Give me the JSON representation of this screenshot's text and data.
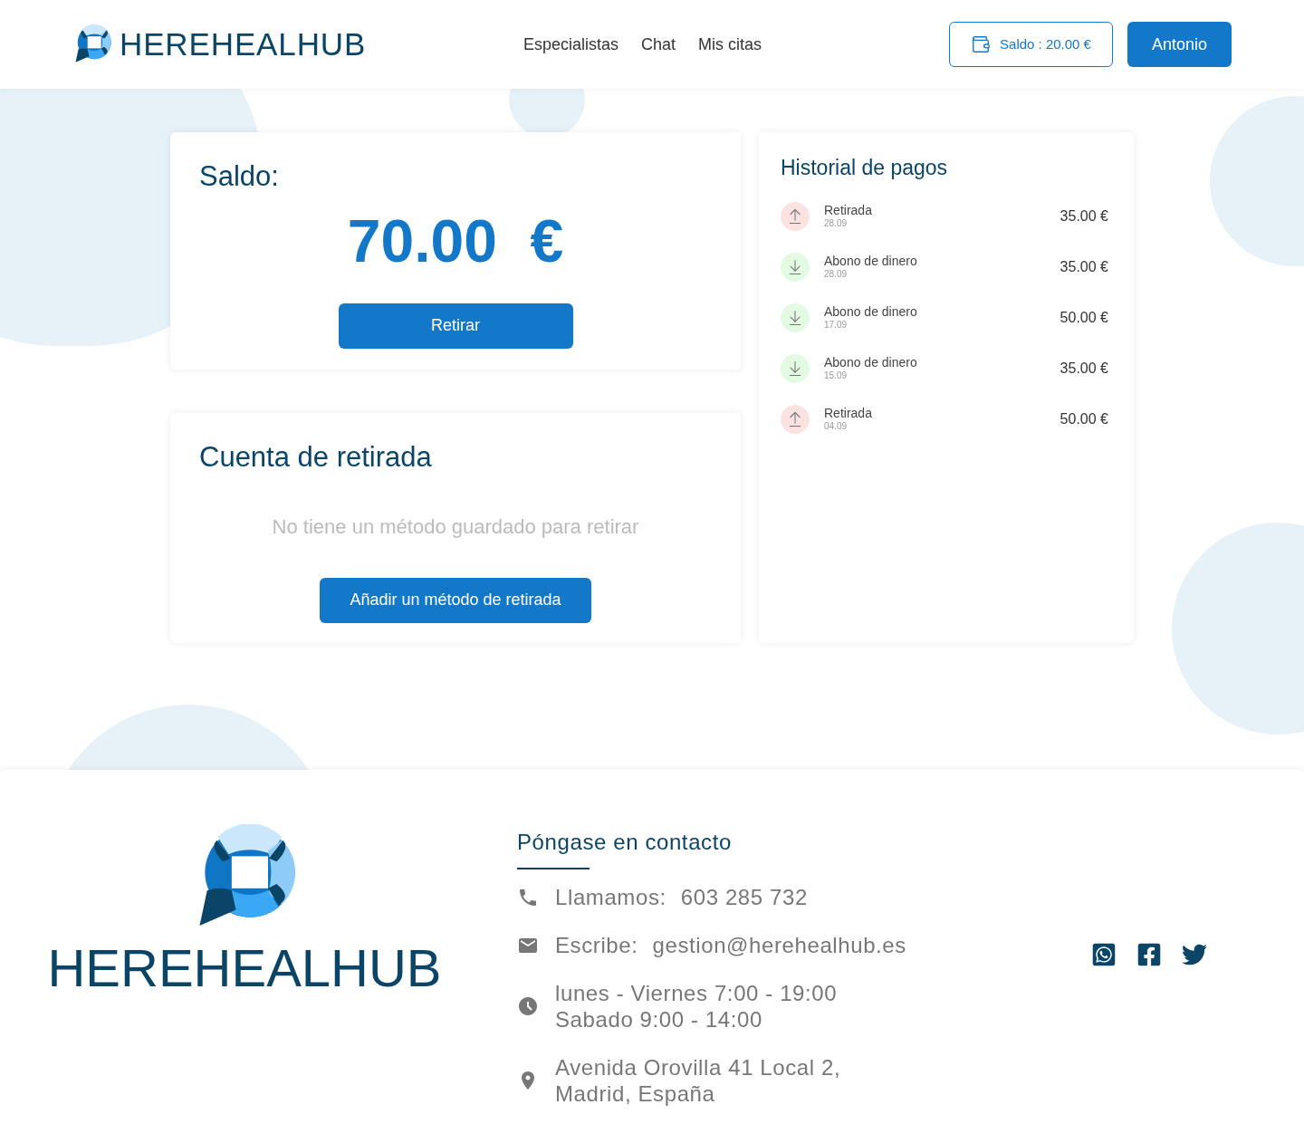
{
  "header": {
    "brand": "HEREHEALHUB",
    "nav": [
      "Especialistas",
      "Chat",
      "Mis citas"
    ],
    "balance_button": "Saldo : 20.00 €",
    "user_button": "Antonio"
  },
  "balance_card": {
    "title": "Saldo:",
    "amount": "70.00  €",
    "button": "Retirar"
  },
  "withdrawal_card": {
    "title": "Cuenta de retirada",
    "empty_message": "No tiene un método guardado para retirar",
    "button": "Añadir un método de retirada"
  },
  "payment_history": {
    "title": "Historial de pagos",
    "items": [
      {
        "kind": "withdrawal",
        "label": "Retirada",
        "date": "28.09",
        "amount": "35.00 €"
      },
      {
        "kind": "deposit",
        "label": "Abono de dinero",
        "date": "28.09",
        "amount": "35.00 €"
      },
      {
        "kind": "deposit",
        "label": "Abono de dinero",
        "date": "17.09",
        "amount": "50.00 €"
      },
      {
        "kind": "deposit",
        "label": "Abono de dinero",
        "date": "15.09",
        "amount": "35.00 €"
      },
      {
        "kind": "withdrawal",
        "label": "Retirada",
        "date": "04.09",
        "amount": "50.00 €"
      }
    ]
  },
  "footer": {
    "brand": "HEREHEALHUB",
    "contact_title": "Póngase en contacto",
    "contacts": [
      {
        "kind": "phone",
        "label": "Llamamos:",
        "lines": [
          "603 285 732"
        ]
      },
      {
        "kind": "email",
        "label": "Escribe:",
        "lines": [
          "gestion@herehealhub.es"
        ]
      },
      {
        "kind": "hours",
        "lines": [
          "lunes - Viernes 7:00 - 19:00",
          "Sabado 9:00 - 14:00"
        ]
      },
      {
        "kind": "address",
        "lines": [
          "Avenida Orovilla 41 Local 2,",
          "Madrid, España"
        ]
      }
    ],
    "social": [
      {
        "kind": "whatsapp"
      },
      {
        "kind": "facebook"
      },
      {
        "kind": "twitter"
      }
    ]
  }
}
